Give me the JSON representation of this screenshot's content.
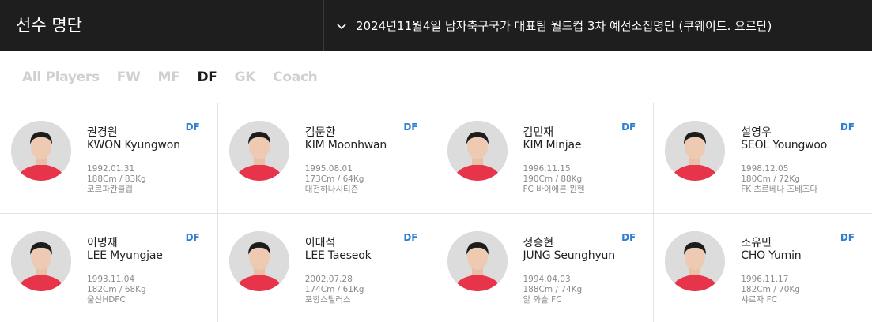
{
  "header": {
    "title": "선수 명단",
    "squad_selector": "2024년11월4일 남자축구국가 대표팀 월드컵 3차 예선소집명단 (쿠웨이트. 요르단)"
  },
  "filters": [
    {
      "label": "All Players",
      "active": false
    },
    {
      "label": "FW",
      "active": false
    },
    {
      "label": "MF",
      "active": false
    },
    {
      "label": "DF",
      "active": true
    },
    {
      "label": "GK",
      "active": false
    },
    {
      "label": "Coach",
      "active": false
    }
  ],
  "players": [
    {
      "kname": "권경원",
      "ename": "KWON Kyungwon",
      "pos": "DF",
      "birth": "1992.01.31",
      "body": "188Cm / 83Kg",
      "club": "코르파칸클럽"
    },
    {
      "kname": "김문환",
      "ename": "KIM Moonhwan",
      "pos": "DF",
      "birth": "1995.08.01",
      "body": "173Cm / 64Kg",
      "club": "대전하나시티즌"
    },
    {
      "kname": "김민재",
      "ename": "KIM Minjae",
      "pos": "DF",
      "birth": "1996.11.15",
      "body": "190Cm / 88Kg",
      "club": "FC 바이에른 뮌헨"
    },
    {
      "kname": "설영우",
      "ename": "SEOL Youngwoo",
      "pos": "DF",
      "birth": "1998.12.05",
      "body": "180Cm / 72Kg",
      "club": "FK 츠르베나 즈베즈다"
    },
    {
      "kname": "이명재",
      "ename": "LEE Myungjae",
      "pos": "DF",
      "birth": "1993.11.04",
      "body": "182Cm / 68Kg",
      "club": "울산HDFC"
    },
    {
      "kname": "이태석",
      "ename": "LEE Taeseok",
      "pos": "DF",
      "birth": "2002.07.28",
      "body": "174Cm / 61Kg",
      "club": "포항스틸러스"
    },
    {
      "kname": "정승현",
      "ename": "JUNG Seunghyun",
      "pos": "DF",
      "birth": "1994.04.03",
      "body": "188Cm / 74Kg",
      "club": "알 와슬 FC"
    },
    {
      "kname": "조유민",
      "ename": "CHO Yumin",
      "pos": "DF",
      "birth": "1996.11.17",
      "body": "182Cm / 70Kg",
      "club": "샤르자 FC"
    }
  ],
  "colors": {
    "header_bg": "#1e1e1e",
    "position_badge": "#2f7fd1",
    "jersey": "#e8344a",
    "inactive_tab": "#d0d0d0"
  },
  "icons": {
    "squad_selector": "chevron-down-icon",
    "player_photo": "player-photo"
  }
}
